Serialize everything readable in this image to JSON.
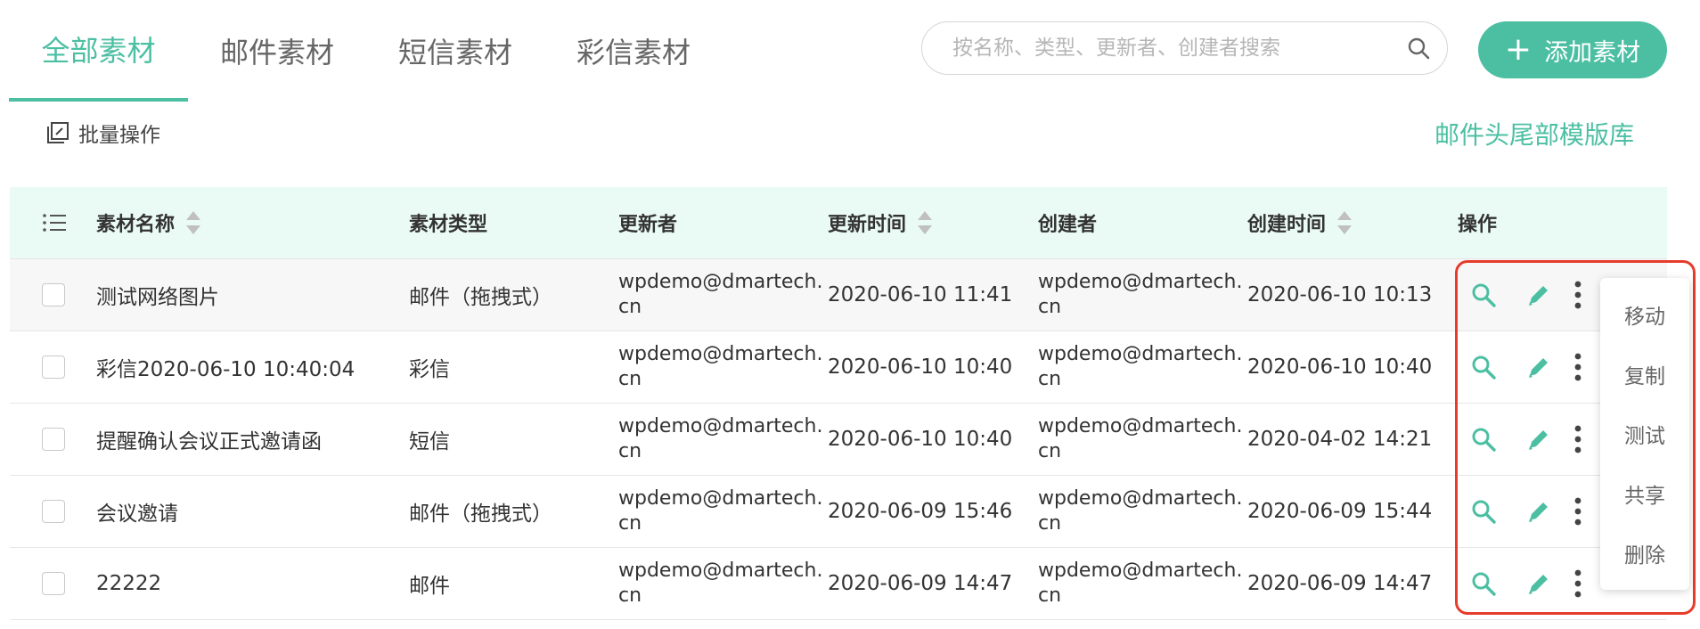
{
  "tabs": [
    {
      "label": "全部素材",
      "active": true
    },
    {
      "label": "邮件素材",
      "active": false
    },
    {
      "label": "短信素材",
      "active": false
    },
    {
      "label": "彩信素材",
      "active": false
    }
  ],
  "search": {
    "placeholder": "按名称、类型、更新者、创建者搜索",
    "icon": "search-icon"
  },
  "add_button": {
    "label": "添加素材",
    "icon": "plus-icon"
  },
  "batch": {
    "label": "批量操作",
    "icon": "batch-edit-icon"
  },
  "header_footer_link": "邮件头尾部模版库",
  "table": {
    "columns": [
      "素材名称",
      "素材类型",
      "更新者",
      "更新时间",
      "创建者",
      "创建时间",
      "操作"
    ],
    "sortable": [
      "素材名称",
      "更新时间",
      "创建时间"
    ],
    "rows": [
      {
        "name": "测试网络图片",
        "type": "邮件（拖拽式）",
        "updater_line1": "wpdemo@dmartech.",
        "updater_line2": "cn",
        "updated": "2020-06-10 11:41",
        "creator_line1": "wpdemo@dmartech.",
        "creator_line2": "cn",
        "created": "2020-06-10 10:13"
      },
      {
        "name": "彩信2020-06-10 10:40:04",
        "type": "彩信",
        "updater_line1": "wpdemo@dmartech.",
        "updater_line2": "cn",
        "updated": "2020-06-10 10:40",
        "creator_line1": "wpdemo@dmartech.",
        "creator_line2": "cn",
        "created": "2020-06-10 10:40"
      },
      {
        "name": "提醒确认会议正式邀请函",
        "type": "短信",
        "updater_line1": "wpdemo@dmartech.",
        "updater_line2": "cn",
        "updated": "2020-06-10 10:40",
        "creator_line1": "wpdemo@dmartech.",
        "creator_line2": "cn",
        "created": "2020-04-02 14:21"
      },
      {
        "name": "会议邀请",
        "type": "邮件（拖拽式）",
        "updater_line1": "wpdemo@dmartech.",
        "updater_line2": "cn",
        "updated": "2020-06-09 15:46",
        "creator_line1": "wpdemo@dmartech.",
        "creator_line2": "cn",
        "created": "2020-06-09 15:44"
      },
      {
        "name": "22222",
        "type": "邮件",
        "updater_line1": "wpdemo@dmartech.",
        "updater_line2": "cn",
        "updated": "2020-06-09 14:47",
        "creator_line1": "wpdemo@dmartech.",
        "creator_line2": "cn",
        "created": "2020-06-09 14:47"
      }
    ]
  },
  "dropdown_menu": [
    "移动",
    "复制",
    "测试",
    "共享",
    "删除"
  ],
  "colors": {
    "accent": "#4cbfa3",
    "header_bg": "#eafaf5",
    "highlight": "#e53c2c"
  }
}
